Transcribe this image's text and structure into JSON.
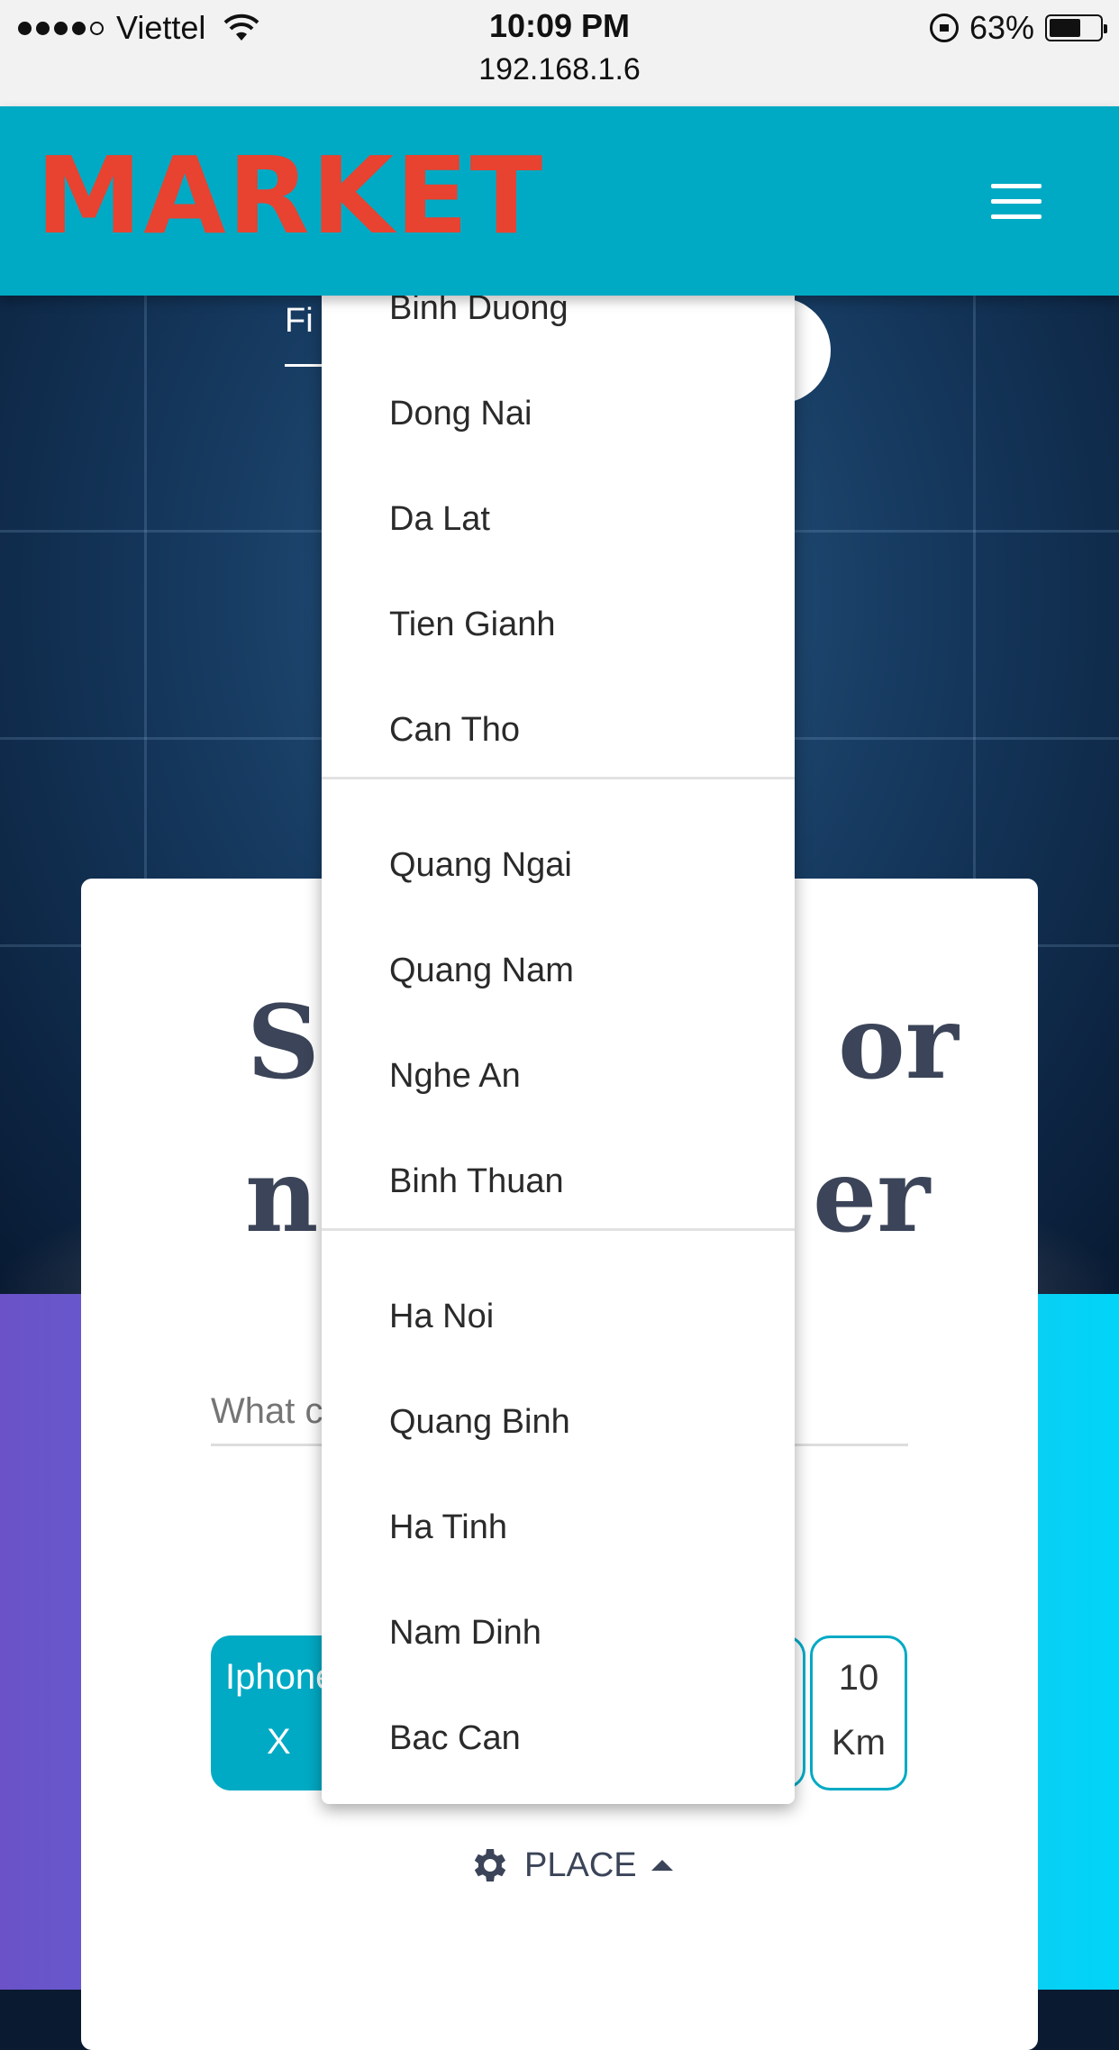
{
  "status_bar": {
    "carrier": "Viettel",
    "time": "10:09 PM",
    "url": "192.168.1.6",
    "battery": "63%",
    "battery_level": 0.63
  },
  "header": {
    "logo": "MARKET",
    "menu_icon": "hamburger-menu-icon"
  },
  "hero": {
    "tab_label": "Fi",
    "title_line1_left": "Se",
    "title_line1_right": "or",
    "title_line2_left": "ne",
    "title_line2_right": "er"
  },
  "search": {
    "placeholder": "What c"
  },
  "chips": {
    "product_line1": "Iphone",
    "product_line2": "X",
    "distance_line1": "10",
    "distance_line2": "Km"
  },
  "place_button": {
    "label": "PLACE",
    "icon": "gear-icon"
  },
  "dropdown": {
    "groups": [
      [
        "Binh Duong",
        "Dong Nai",
        "Da Lat",
        "Tien Gianh",
        "Can Tho"
      ],
      [
        "Quang Ngai",
        "Quang Nam",
        "Nghe An",
        "Binh Thuan"
      ],
      [
        "Ha Noi",
        "Quang Binh",
        "Ha Tinh",
        "Nam Dinh",
        "Bac Can"
      ]
    ]
  },
  "colors": {
    "header": "#00aac4",
    "logo": "#e84230",
    "title": "#3b4458"
  }
}
